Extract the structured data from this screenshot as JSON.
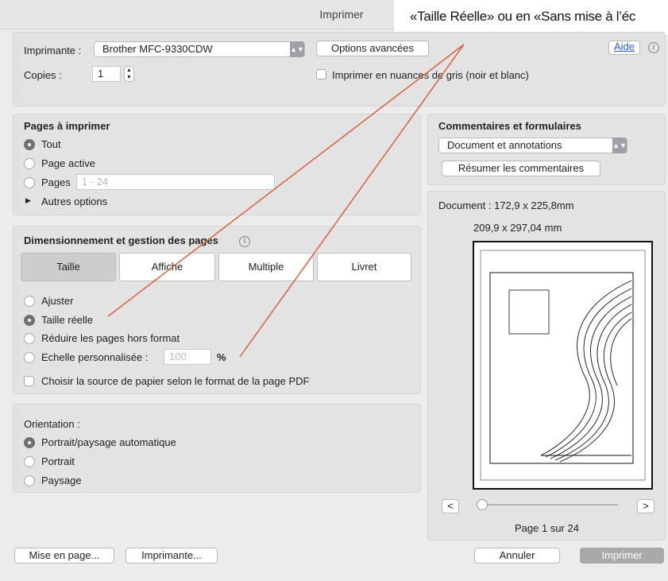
{
  "window": {
    "title": "Imprimer"
  },
  "annotation": {
    "text": "«Taille Réelle» ou en «Sans mise à l’éc"
  },
  "printer": {
    "label": "Imprimante :",
    "selected": "Brother MFC-9330CDW",
    "advanced_button": "Options avancées",
    "help_button": "Aide",
    "copies_label": "Copies :",
    "copies_value": "1",
    "grayscale_label": "Imprimer en nuances de gris (noir et blanc)"
  },
  "pages": {
    "heading": "Pages à imprimer",
    "all": "Tout",
    "current": "Page active",
    "range": "Pages",
    "range_placeholder": "1 - 24",
    "more": "Autres options"
  },
  "sizing": {
    "heading": "Dimensionnement et gestion des pages",
    "tabs": [
      "Taille",
      "Affiche",
      "Multiple",
      "Livret"
    ],
    "fit": "Ajuster",
    "actual": "Taille réelle",
    "shrink": "Réduire les pages hors format",
    "custom": "Echelle personnalisée :",
    "custom_value": "100",
    "custom_unit": "%",
    "paper_source": "Choisir la source de papier selon le format de la page PDF"
  },
  "orientation": {
    "heading": "Orientation :",
    "auto": "Portrait/paysage automatique",
    "portrait": "Portrait",
    "landscape": "Paysage"
  },
  "comments": {
    "heading": "Commentaires et formulaires",
    "selected": "Document et annotations",
    "summarize_button": "Résumer les commentaires"
  },
  "preview": {
    "document_size": "Document : 172,9 x 225,8mm",
    "page_size": "209,9 x 297,04 mm",
    "prev": "<",
    "next": ">",
    "page_indicator": "Page 1 sur 24",
    "zoom_level": 0.0
  },
  "footer": {
    "page_setup": "Mise en page...",
    "printer": "Imprimante...",
    "cancel": "Annuler",
    "print": "Imprimer"
  },
  "colors": {
    "annotation_line": "#d9603a",
    "print_button_bg": "#a9a9a9"
  }
}
